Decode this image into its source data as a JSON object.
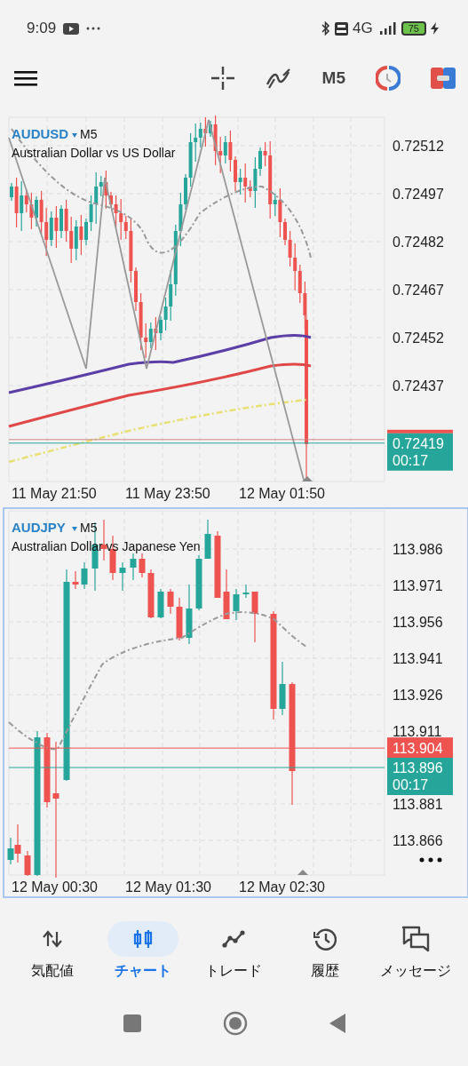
{
  "status_bar": {
    "time": "9:09",
    "network": "4G",
    "battery": "75"
  },
  "toolbar": {
    "timeframe": "M5"
  },
  "charts": [
    {
      "symbol": "AUDUSD",
      "timeframe": "M5",
      "description": "Australian Dollar vs US Dollar",
      "selected": false,
      "price_labels": [
        "0.72512",
        "0.72497",
        "0.72482",
        "0.72467",
        "0.72452",
        "0.72437"
      ],
      "bid": {
        "price": "0.72419",
        "countdown": "00:17"
      },
      "time_labels": [
        "11 May 21:50",
        "11 May 23:50",
        "12 May 01:50"
      ]
    },
    {
      "symbol": "AUDJPY",
      "timeframe": "M5",
      "description": "Australian Dollar vs Japanese Yen",
      "selected": true,
      "price_labels": [
        "113.986",
        "113.971",
        "113.956",
        "113.941",
        "113.926",
        "113.911",
        "113.881",
        "113.866"
      ],
      "ask": {
        "price": "113.904"
      },
      "bid": {
        "price": "113.896",
        "countdown": "00:17"
      },
      "time_labels": [
        "12 May 00:30",
        "12 May 01:30",
        "12 May 02:30"
      ]
    }
  ],
  "bottom_nav": [
    {
      "kind": "quotes",
      "label": "気配値",
      "selected": false
    },
    {
      "kind": "chart",
      "label": "チャート",
      "selected": true
    },
    {
      "kind": "trade",
      "label": "トレード",
      "selected": false
    },
    {
      "kind": "history",
      "label": "履歴",
      "selected": false
    },
    {
      "kind": "messages",
      "label": "メッセージ",
      "selected": false
    }
  ]
}
